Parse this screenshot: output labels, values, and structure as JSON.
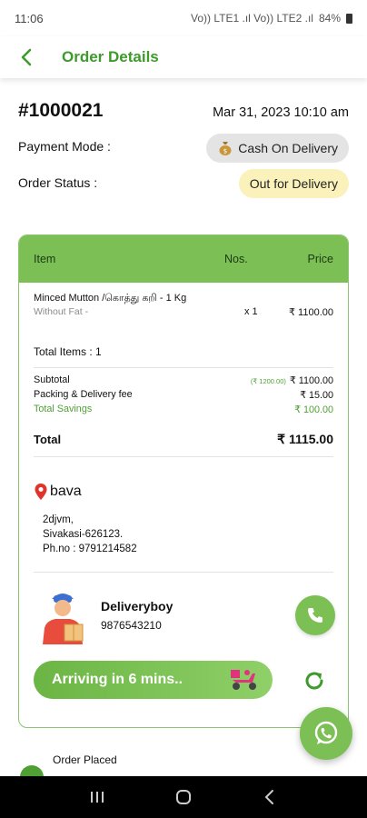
{
  "status_bar": {
    "time": "11:06",
    "signal": "Vo)) LTE1 .ıl Vo)) LTE2 .ıl",
    "battery": "84%"
  },
  "header": {
    "title": "Order Details",
    "back_icon": "chevron-left-icon"
  },
  "order": {
    "id": "#1000021",
    "date": "Mar 31, 2023 10:10 am",
    "payment_label": "Payment Mode :",
    "payment_value": "Cash On Delivery",
    "payment_icon": "money-bag-icon",
    "status_label": "Order Status :",
    "status_value": "Out for Delivery"
  },
  "table": {
    "col_item": "Item",
    "col_nos": "Nos.",
    "col_price": "Price",
    "items": [
      {
        "name": "Minced Mutton /கொத்து கறி - 1 Kg",
        "note": "Without Fat -",
        "qty": "x 1",
        "price": "₹ 1100.00"
      }
    ],
    "total_items_label": "Total Items :",
    "total_items_value": "1"
  },
  "summary": {
    "subtotal_label": "Subtotal",
    "subtotal_strike": "(₹ 1200.00)",
    "subtotal_value": "₹ 1100.00",
    "delivery_label": "Packing & Delivery fee",
    "delivery_value": "₹ 15.00",
    "savings_label": "Total Savings",
    "savings_value": "₹ 100.00",
    "total_label": "Total",
    "total_value": "₹ 1115.00"
  },
  "address": {
    "pin_icon": "location-pin-icon",
    "name": "bava",
    "line1": "2djvm,",
    "line2": "Sivakasi-626123.",
    "phone": "Ph.no : 9791214582"
  },
  "delivery": {
    "avatar_icon": "delivery-boy-avatar-icon",
    "name": "Deliveryboy",
    "phone": "9876543210",
    "call_icon": "phone-icon",
    "arriving_text": "Arriving  in 6 mins..",
    "scooter_icon": "scooter-icon",
    "refresh_icon": "refresh-icon"
  },
  "whatsapp_icon": "whatsapp-icon",
  "tracking": {
    "first_step": "Order Placed"
  },
  "colors": {
    "primary": "#7bbf55",
    "accent_text": "#3d9a2b",
    "status_pill": "#fbf2bb"
  }
}
